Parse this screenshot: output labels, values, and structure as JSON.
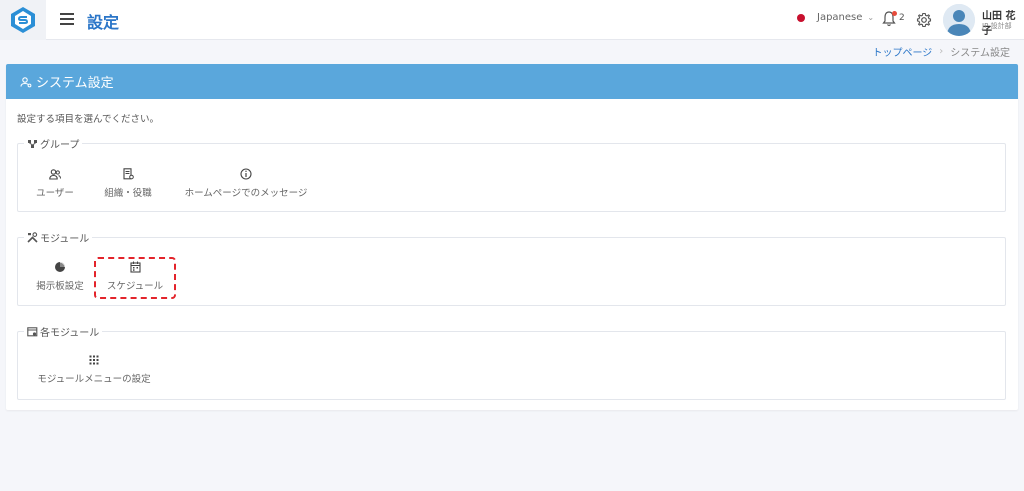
{
  "header": {
    "title": "設定",
    "language": "Japanese",
    "notification_count": "2",
    "user_name": "山田 花子",
    "user_dept": "JP-設計部"
  },
  "breadcrumb": {
    "home": "トップページ",
    "separator": "›",
    "current": "システム設定"
  },
  "panel": {
    "title": "システム設定",
    "instruction": "設定する項目を選んでください。"
  },
  "groups": {
    "group": {
      "legend": "グループ",
      "items": [
        {
          "label": "ユーザー",
          "icon": "users-icon"
        },
        {
          "label": "組織・役職",
          "icon": "org-doc-icon"
        },
        {
          "label": "ホームページでのメッセージ",
          "icon": "info-icon"
        }
      ]
    },
    "module": {
      "legend": "モジュール",
      "items": [
        {
          "label": "掲示板設定",
          "icon": "pie-chart-icon"
        },
        {
          "label": "スケジュール",
          "icon": "calendar-icon"
        }
      ]
    },
    "each_module": {
      "legend": "各モジュール",
      "items": [
        {
          "label": "モジュールメニューの設定",
          "icon": "grid-icon"
        }
      ]
    }
  },
  "colors": {
    "accent": "#2b76c8",
    "panel_header": "#5aa7dc",
    "highlight": "#e3242b",
    "flag_dot": "#c8102e"
  }
}
